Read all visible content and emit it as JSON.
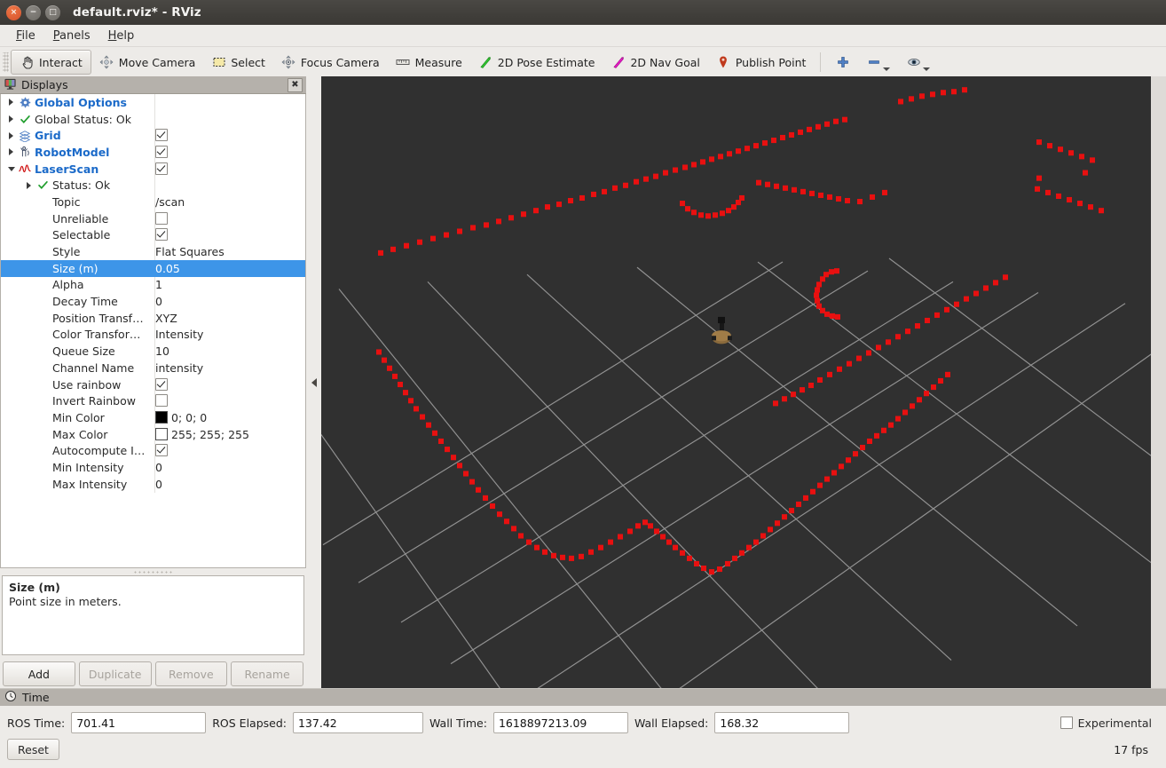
{
  "window": {
    "title": "default.rviz* - RViz",
    "buttons": {
      "close": "×",
      "minimize": "−",
      "maximize": "□"
    }
  },
  "menubar": [
    {
      "label": "File",
      "mnemonic": "F"
    },
    {
      "label": "Panels",
      "mnemonic": "P"
    },
    {
      "label": "Help",
      "mnemonic": "H"
    }
  ],
  "toolbar": {
    "items": [
      {
        "label": "Interact",
        "icon": "hand-cursor-icon",
        "active": true
      },
      {
        "label": "Move Camera",
        "icon": "move-camera-icon",
        "active": false
      },
      {
        "label": "Select",
        "icon": "select-rect-icon",
        "active": false
      },
      {
        "label": "Focus Camera",
        "icon": "focus-camera-icon",
        "active": false
      },
      {
        "label": "Measure",
        "icon": "ruler-icon",
        "active": false
      },
      {
        "label": "2D Pose Estimate",
        "icon": "pose-arrow-icon",
        "active": false
      },
      {
        "label": "2D Nav Goal",
        "icon": "nav-goal-arrow-icon",
        "active": false
      },
      {
        "label": "Publish Point",
        "icon": "map-pin-icon",
        "active": false
      }
    ],
    "zoom_in_icon": "plus-icon",
    "zoom_out_icon": "minus-icon",
    "views_icon": "eye-icon"
  },
  "displays_panel": {
    "title": "Displays",
    "close_label": "✖",
    "rows": [
      {
        "indent": 0,
        "arrow": "closed",
        "icon": "gear-icon",
        "label": "Global Options",
        "bold": true,
        "value_type": "none",
        "value": ""
      },
      {
        "indent": 0,
        "arrow": "closed",
        "icon": "check-icon",
        "label": "Global Status: Ok",
        "bold": false,
        "value_type": "none",
        "value": ""
      },
      {
        "indent": 0,
        "arrow": "closed",
        "icon": "grid-icon",
        "label": "Grid",
        "bold": true,
        "value_type": "checkbox",
        "value": "checked"
      },
      {
        "indent": 0,
        "arrow": "closed",
        "icon": "robot-icon",
        "label": "RobotModel",
        "bold": true,
        "value_type": "checkbox",
        "value": "checked"
      },
      {
        "indent": 0,
        "arrow": "open",
        "icon": "laserscan-icon",
        "label": "LaserScan",
        "bold": true,
        "value_type": "checkbox",
        "value": "checked"
      },
      {
        "indent": 1,
        "arrow": "closed",
        "icon": "check-icon",
        "label": "Status: Ok",
        "bold": false,
        "value_type": "none",
        "value": ""
      },
      {
        "indent": 1,
        "arrow": "none",
        "icon": "none",
        "label": "Topic",
        "bold": false,
        "value_type": "text",
        "value": "/scan"
      },
      {
        "indent": 1,
        "arrow": "none",
        "icon": "none",
        "label": "Unreliable",
        "bold": false,
        "value_type": "checkbox",
        "value": "unchecked"
      },
      {
        "indent": 1,
        "arrow": "none",
        "icon": "none",
        "label": "Selectable",
        "bold": false,
        "value_type": "checkbox",
        "value": "checked"
      },
      {
        "indent": 1,
        "arrow": "none",
        "icon": "none",
        "label": "Style",
        "bold": false,
        "value_type": "text",
        "value": "Flat Squares"
      },
      {
        "indent": 1,
        "arrow": "none",
        "icon": "none",
        "label": "Size (m)",
        "bold": false,
        "value_type": "text",
        "value": "0.05",
        "selected": true
      },
      {
        "indent": 1,
        "arrow": "none",
        "icon": "none",
        "label": "Alpha",
        "bold": false,
        "value_type": "text",
        "value": "1"
      },
      {
        "indent": 1,
        "arrow": "none",
        "icon": "none",
        "label": "Decay Time",
        "bold": false,
        "value_type": "text",
        "value": "0"
      },
      {
        "indent": 1,
        "arrow": "none",
        "icon": "none",
        "label": "Position Transf…",
        "bold": false,
        "value_type": "text",
        "value": "XYZ"
      },
      {
        "indent": 1,
        "arrow": "none",
        "icon": "none",
        "label": "Color Transfor…",
        "bold": false,
        "value_type": "text",
        "value": "Intensity"
      },
      {
        "indent": 1,
        "arrow": "none",
        "icon": "none",
        "label": "Queue Size",
        "bold": false,
        "value_type": "text",
        "value": "10"
      },
      {
        "indent": 1,
        "arrow": "none",
        "icon": "none",
        "label": "Channel Name",
        "bold": false,
        "value_type": "text",
        "value": "intensity"
      },
      {
        "indent": 1,
        "arrow": "none",
        "icon": "none",
        "label": "Use rainbow",
        "bold": false,
        "value_type": "checkbox",
        "value": "checked"
      },
      {
        "indent": 1,
        "arrow": "none",
        "icon": "none",
        "label": "Invert Rainbow",
        "bold": false,
        "value_type": "checkbox",
        "value": "unchecked"
      },
      {
        "indent": 1,
        "arrow": "none",
        "icon": "none",
        "label": "Min Color",
        "bold": false,
        "value_type": "color",
        "value": "0; 0; 0",
        "color": "#000000"
      },
      {
        "indent": 1,
        "arrow": "none",
        "icon": "none",
        "label": "Max Color",
        "bold": false,
        "value_type": "color",
        "value": "255; 255; 255",
        "color": "#ffffff"
      },
      {
        "indent": 1,
        "arrow": "none",
        "icon": "none",
        "label": "Autocompute I…",
        "bold": false,
        "value_type": "checkbox",
        "value": "checked"
      },
      {
        "indent": 1,
        "arrow": "none",
        "icon": "none",
        "label": "Min Intensity",
        "bold": false,
        "value_type": "text",
        "value": "0"
      },
      {
        "indent": 1,
        "arrow": "none",
        "icon": "none",
        "label": "Max Intensity",
        "bold": false,
        "value_type": "text",
        "value": "0"
      }
    ],
    "description": {
      "title": "Size (m)",
      "text": "Point size in meters."
    },
    "buttons": [
      {
        "label": "Add",
        "enabled": true
      },
      {
        "label": "Duplicate",
        "enabled": false
      },
      {
        "label": "Remove",
        "enabled": false
      },
      {
        "label": "Rename",
        "enabled": false
      }
    ]
  },
  "time_panel": {
    "title": "Time",
    "fields": [
      {
        "label": "ROS Time:",
        "value": "701.41"
      },
      {
        "label": "ROS Elapsed:",
        "value": "137.42"
      },
      {
        "label": "Wall Time:",
        "value": "1618897213.09"
      },
      {
        "label": "Wall Elapsed:",
        "value": "168.32"
      }
    ],
    "experimental": {
      "label": "Experimental",
      "checked": false
    },
    "reset_label": "Reset",
    "fps": "17 fps"
  },
  "viewport": {
    "background": "#303030",
    "grid_color": "#a8a8a8",
    "scan_color": "#e81010",
    "robot_body_color": "#8a6a3c",
    "robot_post_color": "#1c1c1c"
  }
}
